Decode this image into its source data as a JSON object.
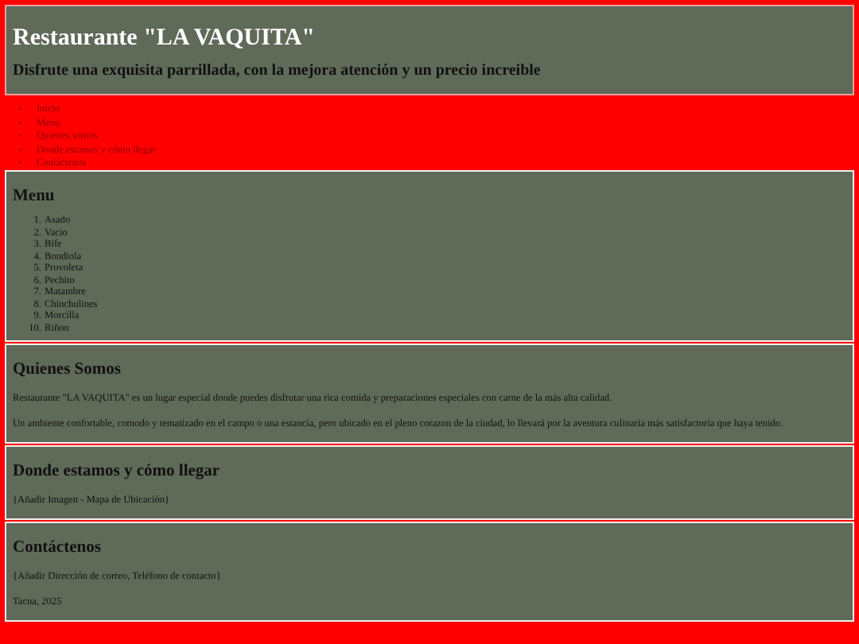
{
  "header": {
    "title": "Restaurante \"LA VAQUITA\"",
    "subtitle": "Disfrute una exquisita parrillada, con la mejora atención y un precio increible"
  },
  "nav": [
    {
      "marker": "•",
      "label": "Inicio"
    },
    {
      "marker": "•",
      "label": "Menú"
    },
    {
      "marker": "•",
      "label": "Quienes somos"
    },
    {
      "marker": "•",
      "label": "Donde estamos y cómo llegar"
    },
    {
      "marker": "•",
      "label": "Contáctenos"
    }
  ],
  "sections": [
    {
      "kind": "list",
      "heading": "Menu",
      "items": [
        {
          "number": "1.",
          "name": "Asado"
        },
        {
          "number": "2.",
          "name": "Vacio"
        },
        {
          "number": "3.",
          "name": "Bife"
        },
        {
          "number": "4.",
          "name": "Bondiola"
        },
        {
          "number": "5.",
          "name": "Provoleta"
        },
        {
          "number": "6.",
          "name": "Pechito"
        },
        {
          "number": "7.",
          "name": "Matambre"
        },
        {
          "number": "8.",
          "name": "Chinchulines"
        },
        {
          "number": "9.",
          "name": "Morcilla"
        },
        {
          "number": "10.",
          "name": "Riñon"
        }
      ]
    },
    {
      "kind": "text",
      "heading": "Quienes Somos",
      "paragraphs": [
        "Restaurante \"LA VAQUITA\" es un lugar especial donde puedes disfrutar una rica comida y preparaciones especiales con carne de la más alta calidad.",
        "Un ambiente confortable, comodo y tematizado en el campo o una estancia, pero ubicado en el pleno corazon de la ciudad, lo llevará por la aventura culinaria más satisfactoria que haya tenido."
      ]
    },
    {
      "kind": "text",
      "heading": "Donde estamos y cómo llegar",
      "paragraphs": [
        "{Añadir Imagen - Mapa de Ubicación}"
      ]
    },
    {
      "kind": "text",
      "heading": "Contáctenos",
      "paragraphs": [
        "{Añadir Dirección de correo, Teléfono de contacto}",
        "Tacna, 2025"
      ]
    }
  ]
}
